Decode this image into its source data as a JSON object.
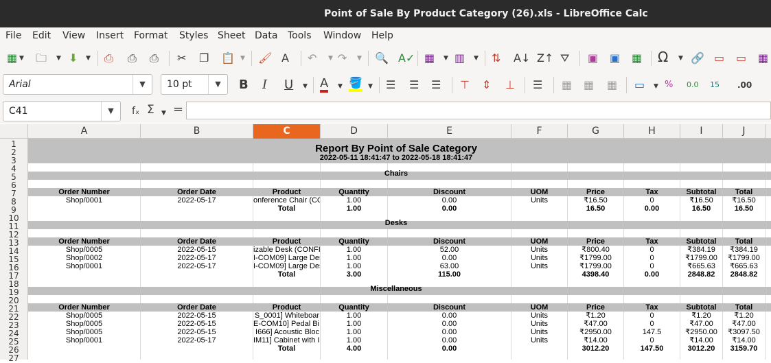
{
  "window": {
    "title": "Point of Sale By Product Category (26).xls - LibreOffice Calc"
  },
  "menu": [
    "File",
    "Edit",
    "View",
    "Insert",
    "Format",
    "Styles",
    "Sheet",
    "Data",
    "Tools",
    "Window",
    "Help"
  ],
  "toolbar2": {
    "font_name": "Arial",
    "font_size": "10 pt"
  },
  "formula_bar": {
    "cell_ref": "C41",
    "fx": "fₓ",
    "sigma": "Σ",
    "equals": "="
  },
  "columns": [
    "A",
    "B",
    "C",
    "D",
    "E",
    "F",
    "G",
    "H",
    "I",
    "J"
  ],
  "selected_column": "C",
  "rows": [
    "1",
    "2",
    "3",
    "4",
    "5",
    "6",
    "7",
    "8",
    "9",
    "10",
    "11",
    "12",
    "13",
    "14",
    "15",
    "16",
    "17",
    "18",
    "19",
    "20",
    "21",
    "22",
    "23",
    "24",
    "25",
    "26",
    "27"
  ],
  "report": {
    "title": "Report By Point of Sale Category",
    "range": "2022-05-11 18:41:47 to 2022-05-18 18:41:47"
  },
  "headers": [
    "Order Number",
    "Order Date",
    "Product",
    "Quantity",
    "Discount",
    "UOM",
    "Price",
    "Tax",
    "Subtotal",
    "Total"
  ],
  "sections": [
    {
      "name": "Chairs",
      "rows": [
        [
          "Shop/0001",
          "2022-05-17",
          "onference Chair (CO",
          "1.00",
          "0.00",
          "Units",
          "₹16.50",
          "0",
          "₹16.50",
          "₹16.50"
        ]
      ],
      "total": {
        "label": "Total",
        "qty": "1.00",
        "discount": "0.00",
        "price": "16.50",
        "tax": "0.00",
        "subtotal": "16.50",
        "total": "16.50"
      }
    },
    {
      "name": "Desks",
      "rows": [
        [
          "Shop/0005",
          "2022-05-15",
          "izable Desk (CONFI",
          "1.00",
          "52.00",
          "Units",
          "₹800.40",
          "0",
          "₹384.19",
          "₹384.19"
        ],
        [
          "Shop/0002",
          "2022-05-17",
          "I-COM09] Large Des",
          "1.00",
          "0.00",
          "Units",
          "₹1799.00",
          "0",
          "₹1799.00",
          "₹1799.00"
        ],
        [
          "Shop/0001",
          "2022-05-17",
          "I-COM09] Large Des",
          "1.00",
          "63.00",
          "Units",
          "₹1799.00",
          "0",
          "₹665.63",
          "₹665.63"
        ]
      ],
      "total": {
        "label": "Total",
        "qty": "3.00",
        "discount": "115.00",
        "price": "4398.40",
        "tax": "0.00",
        "subtotal": "2848.82",
        "total": "2848.82"
      }
    },
    {
      "name": "Miscellaneous",
      "rows": [
        [
          "Shop/0005",
          "2022-05-15",
          "S_0001] Whiteboar",
          "1.00",
          "0.00",
          "Units",
          "₹1.20",
          "0",
          "₹1.20",
          "₹1.20"
        ],
        [
          "Shop/0005",
          "2022-05-15",
          "E-COM10] Pedal Bi",
          "1.00",
          "0.00",
          "Units",
          "₹47.00",
          "0",
          "₹47.00",
          "₹47.00"
        ],
        [
          "Shop/0005",
          "2022-05-15",
          "I666] Acoustic Bloc",
          "1.00",
          "0.00",
          "Units",
          "₹2950.00",
          "147.5",
          "₹2950.00",
          "₹3097.50"
        ],
        [
          "Shop/0001",
          "2022-05-17",
          "IM11] Cabinet with I",
          "1.00",
          "0.00",
          "Units",
          "₹14.00",
          "0",
          "₹14.00",
          "₹14.00"
        ]
      ],
      "total": {
        "label": "Total",
        "qty": "4.00",
        "discount": "0.00",
        "price": "3012.20",
        "tax": "147.50",
        "subtotal": "3012.20",
        "total": "3159.70"
      }
    }
  ]
}
